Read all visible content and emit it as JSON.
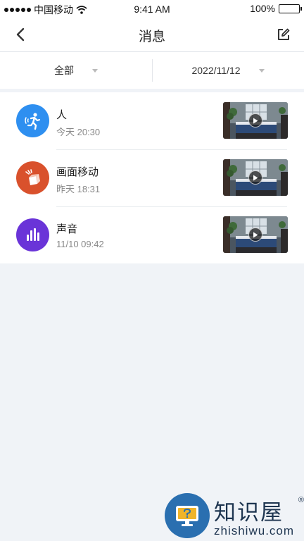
{
  "status_bar": {
    "carrier": "中国移动",
    "time": "9:41 AM",
    "battery": "100%",
    "battery_level": 1.0
  },
  "header": {
    "title": "消息",
    "back_icon": "chevron-left-icon",
    "edit_icon": "edit-icon"
  },
  "filters": {
    "type_label": "全部",
    "date_label": "2022/11/12"
  },
  "events": [
    {
      "title": "人",
      "time": "今天 20:30",
      "icon": "running-person-icon",
      "color": "#2e8ff0"
    },
    {
      "title": "画面移动",
      "time": "昨天 18:31",
      "icon": "moving-box-icon",
      "color": "#d9512c"
    },
    {
      "title": "声音",
      "time": "11/10 09:42",
      "icon": "sound-bars-icon",
      "color": "#6a34d8"
    }
  ],
  "watermark": {
    "name": "知识屋",
    "url": "zhishiwu.com",
    "registered": "®"
  }
}
